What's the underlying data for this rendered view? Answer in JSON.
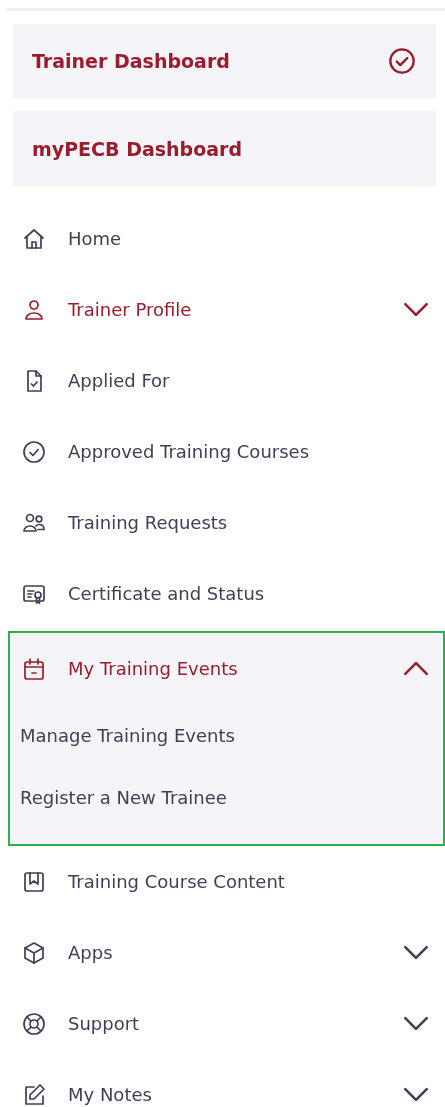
{
  "dashboards": [
    {
      "label": "Trainer Dashboard",
      "selected": true
    },
    {
      "label": "myPECB Dashboard",
      "selected": false
    }
  ],
  "menu": [
    {
      "label": "Home",
      "active": false
    },
    {
      "label": "Trainer Profile",
      "active": true,
      "expanded": false
    },
    {
      "label": "Applied For",
      "active": false
    },
    {
      "label": "Approved Training Courses",
      "active": false
    },
    {
      "label": "Training Requests",
      "active": false
    },
    {
      "label": "Certificate and Status",
      "active": false
    },
    {
      "label": "My Training Events",
      "active": true,
      "expanded": true,
      "children": [
        {
          "label": "Manage Training Events"
        },
        {
          "label": "Register a New Trainee"
        }
      ]
    },
    {
      "label": "Training Course Content",
      "active": false
    },
    {
      "label": "Apps",
      "active": false,
      "expanded": false
    },
    {
      "label": "Support",
      "active": false,
      "expanded": false
    },
    {
      "label": "My Notes",
      "active": false,
      "expanded": false
    }
  ]
}
